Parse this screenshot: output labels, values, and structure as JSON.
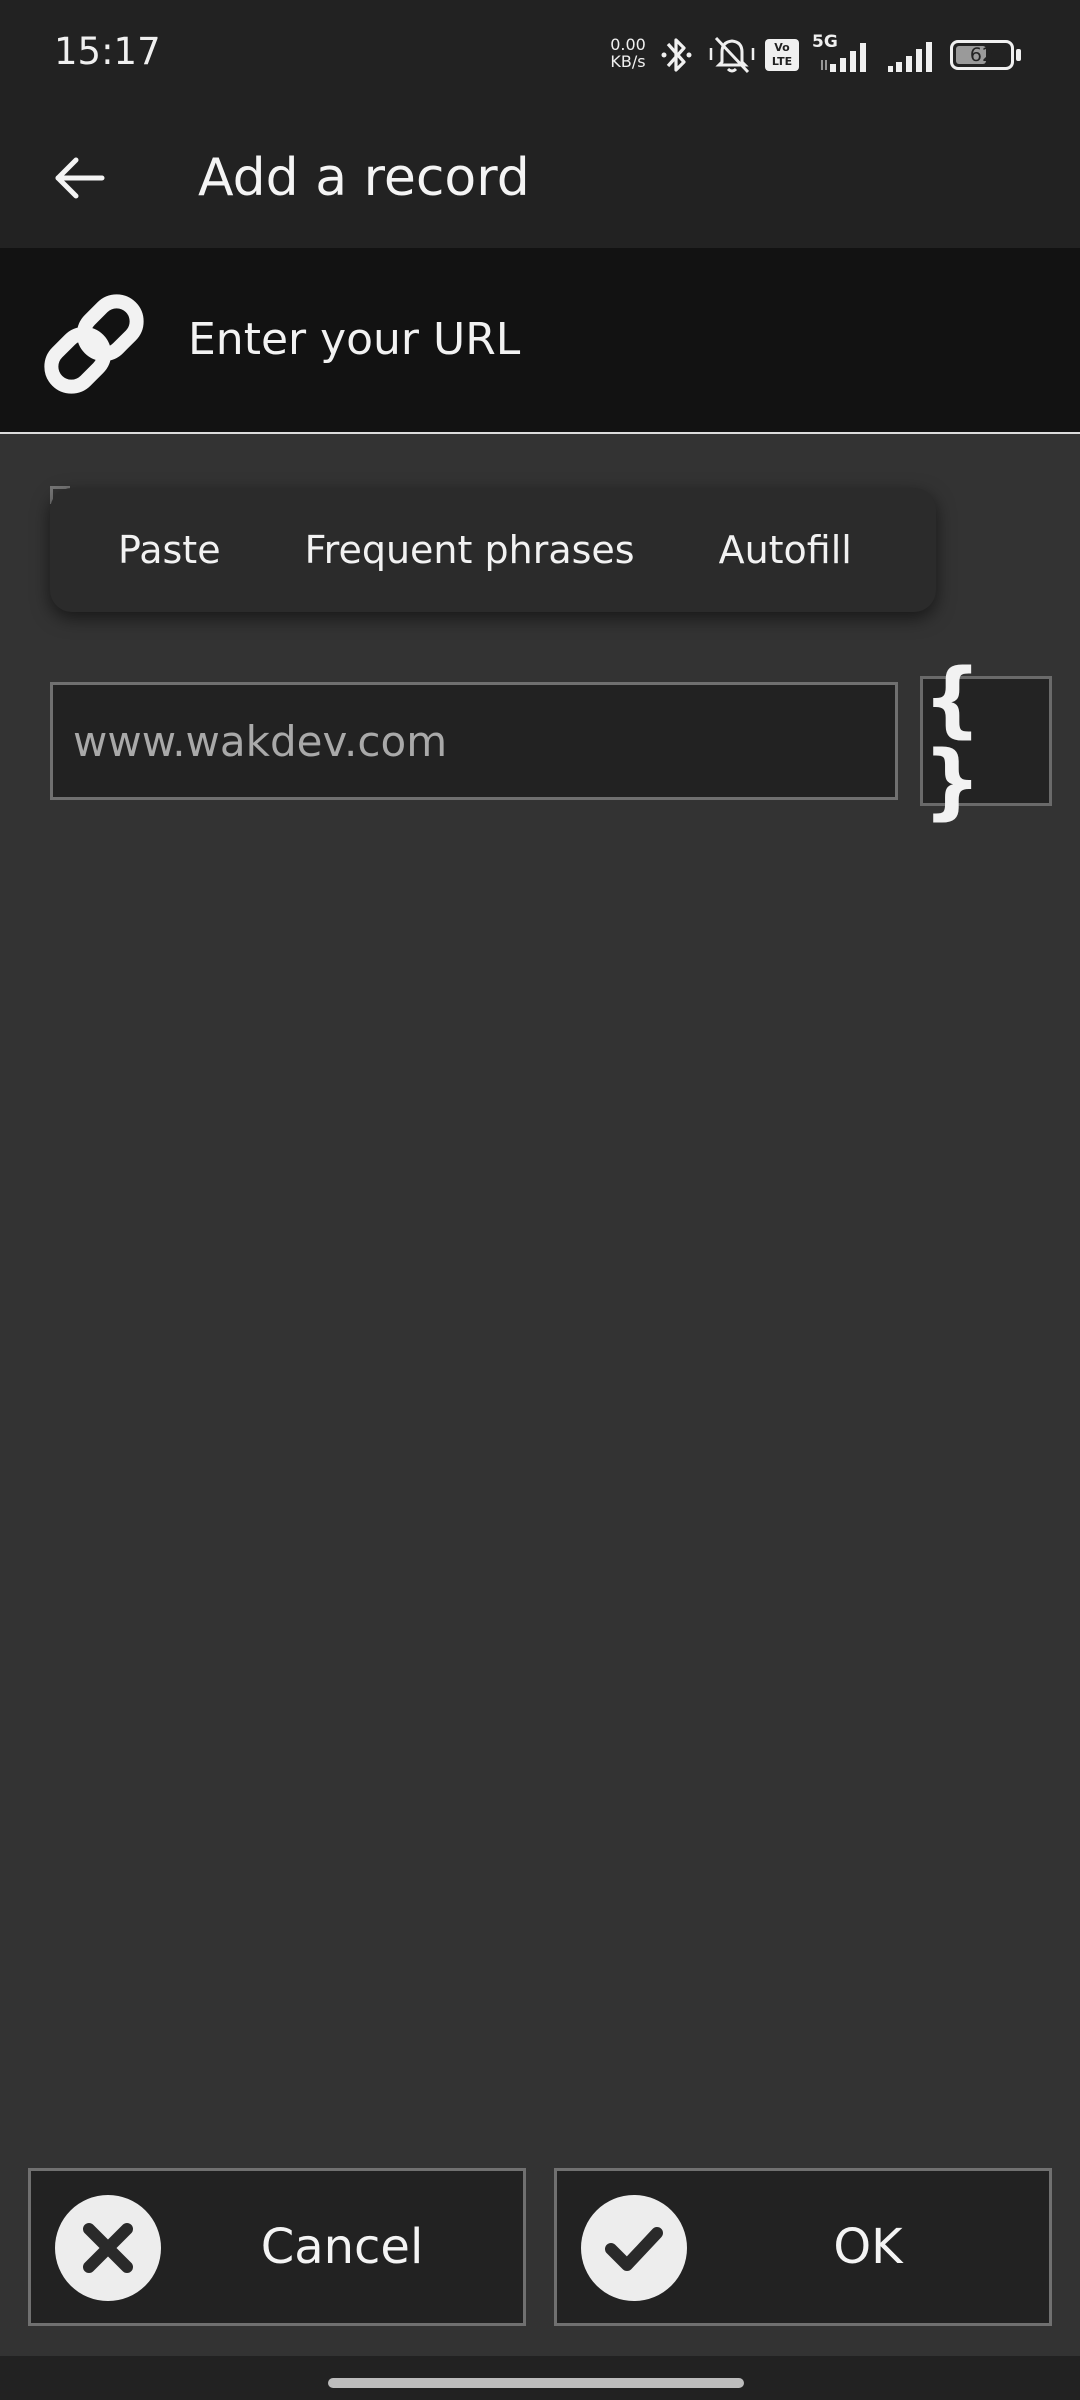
{
  "status_bar": {
    "time": "15:17",
    "net_speed_value": "0.00",
    "net_speed_unit": "KB/s",
    "network_type": "5G",
    "volte_label": "Vo LTE",
    "battery_level": "62",
    "icons": [
      "bluetooth-icon",
      "mute-icon",
      "volte-icon",
      "signal-icon",
      "signal-icon",
      "battery-icon"
    ]
  },
  "app_bar": {
    "title": "Add a record",
    "back_icon": "arrow-left-icon"
  },
  "url_header": {
    "icon": "link-icon",
    "label": "Enter your URL"
  },
  "context_menu": {
    "items": [
      "Paste",
      "Frequent phrases",
      "Autofill"
    ]
  },
  "url_input": {
    "placeholder": "www.wakdev.com",
    "value": ""
  },
  "variables_button": {
    "icon": "braces-icon",
    "glyph": "{ }"
  },
  "buttons": {
    "cancel_label": "Cancel",
    "ok_label": "OK"
  },
  "colors": {
    "background": "#333333",
    "bar": "#222222",
    "header": "#121212",
    "text": "#f2f2f2"
  }
}
